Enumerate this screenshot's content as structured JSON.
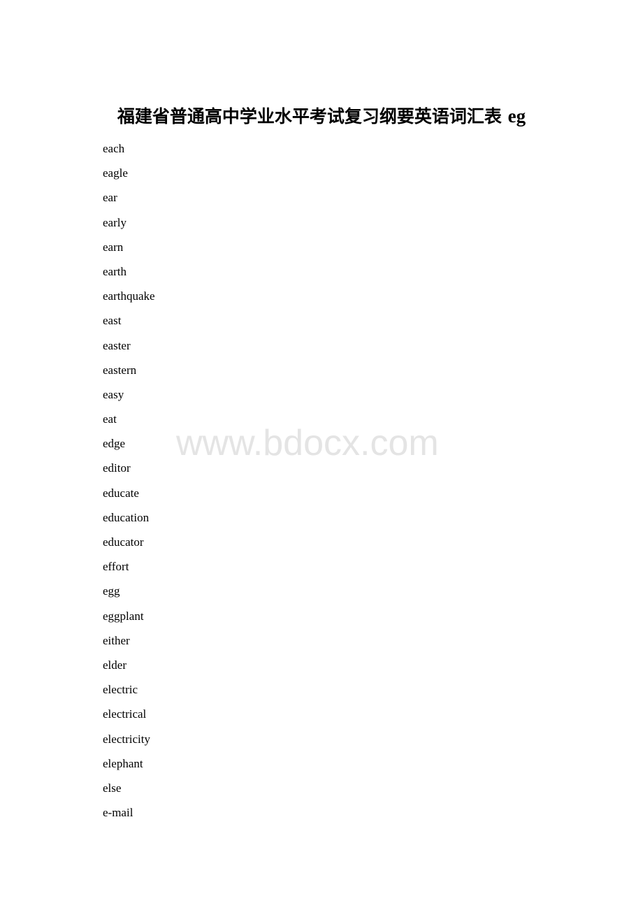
{
  "document": {
    "title_cn": "福建省普通高中学业水平考试复习纲要英语词汇表",
    "title_suffix": "eg",
    "words": [
      "each",
      "eagle",
      "ear",
      "early",
      "earn",
      "earth",
      "earthquake",
      "east",
      "easter",
      "eastern",
      "easy",
      "eat",
      "edge",
      "editor",
      "educate",
      "education",
      "educator",
      "effort",
      "egg",
      "eggplant",
      "either",
      "elder",
      "electric",
      "electrical",
      "electricity",
      "elephant",
      "else",
      "e-mail"
    ],
    "watermark": "www.bdocx.com"
  }
}
